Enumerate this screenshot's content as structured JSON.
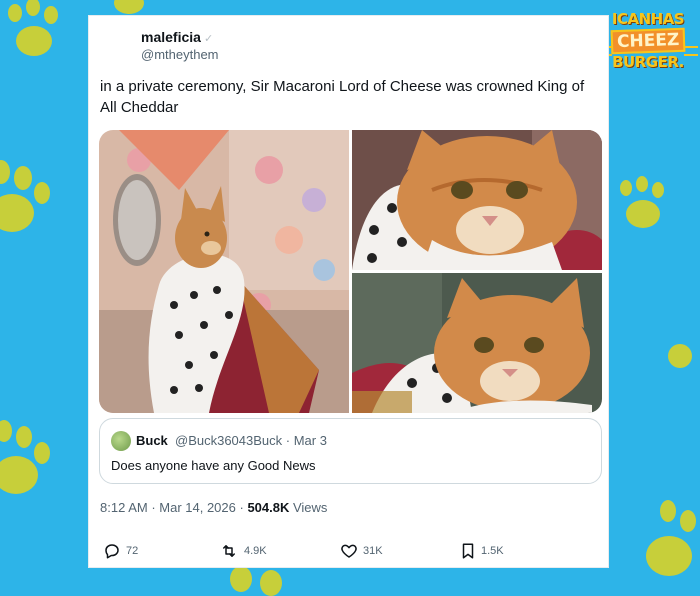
{
  "tweet": {
    "author_name": "maleficia",
    "author_handle": "@mtheythem",
    "text": "in a private ceremony, Sir Macaroni Lord of Cheese was crowned King of All Cheddar",
    "time": "8:12 AM",
    "separator": " · ",
    "date": "Mar 14, 2026",
    "separator2": " · ",
    "views_count": "504.8K",
    "views_label": " Views"
  },
  "quote": {
    "name": "Buck",
    "meta": "@Buck36043Buck · Mar 3",
    "text": "Does anyone have any Good News"
  },
  "actions": {
    "replies": "72",
    "reposts": "4.9K",
    "likes": "31K",
    "bookmarks": "1.5K"
  },
  "logo": {
    "line1": "ICANHAS",
    "line2": "CHEEZ",
    "line3": "BURGER."
  },
  "colors": {
    "background": "#2db4e8",
    "paw": "#c7cf3a",
    "card": "#ffffff",
    "logo_orange": "#f2902a",
    "logo_yellow": "#f6c51c"
  }
}
